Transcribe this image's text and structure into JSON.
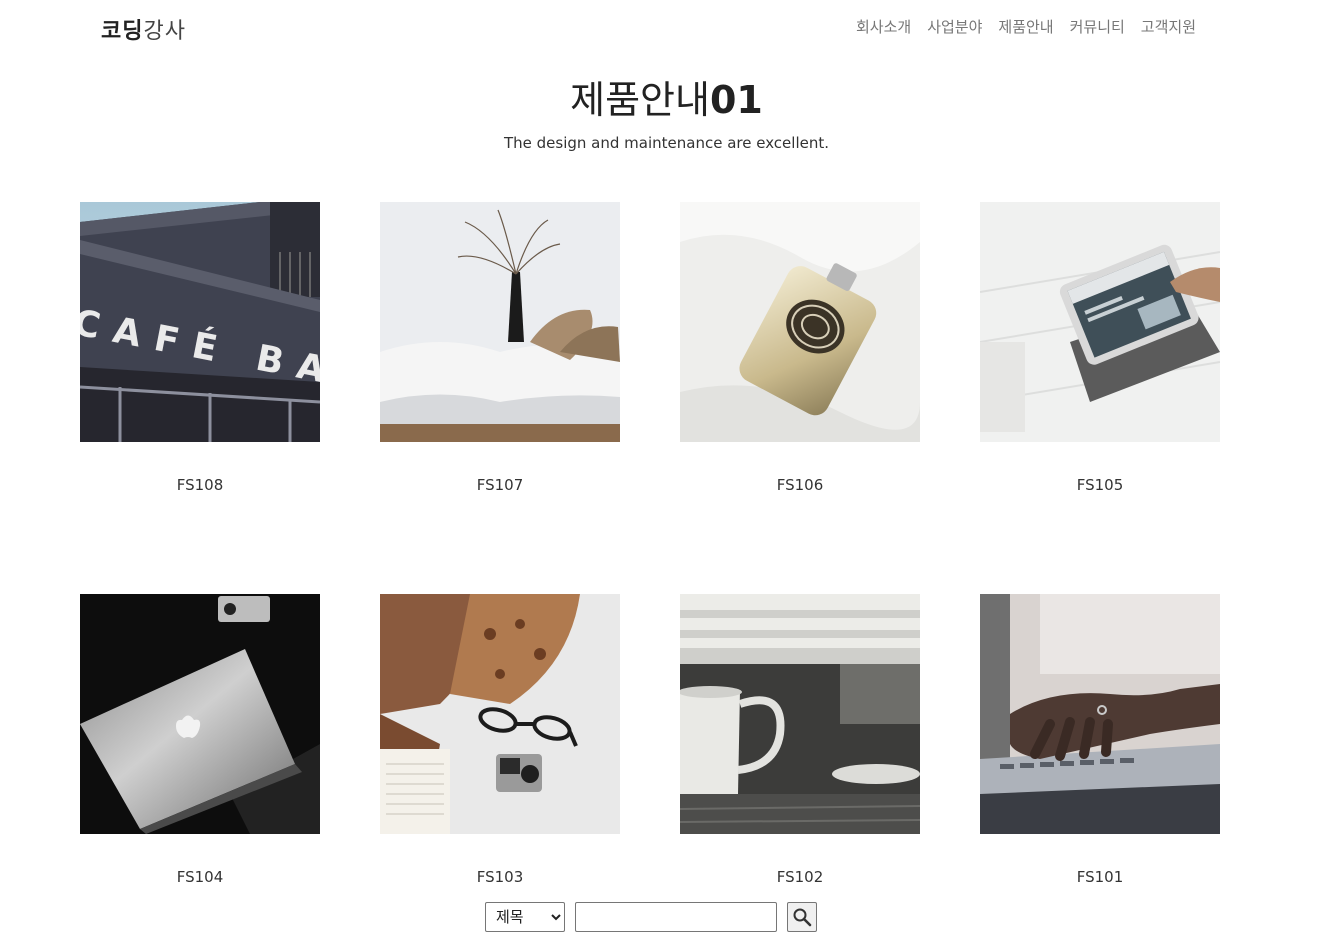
{
  "header": {
    "logo_main": "코딩",
    "logo_sub": "강사",
    "nav": [
      "회사소개",
      "사업분야",
      "제품안내",
      "커뮤니티",
      "고객지원"
    ]
  },
  "page": {
    "title_text": "제품안내",
    "title_num": "01",
    "description": "The design and maintenance are excellent."
  },
  "products": [
    {
      "code": "FS108",
      "image": "cafe-storefront-photo",
      "sign_text": "CAFÉ BA"
    },
    {
      "code": "FS107",
      "image": "white-sofa-photo"
    },
    {
      "code": "FS106",
      "image": "hip-flask-photo"
    },
    {
      "code": "FS105",
      "image": "tablet-photo"
    },
    {
      "code": "FS104",
      "image": "laptop-photo"
    },
    {
      "code": "FS103",
      "image": "desk-items-photo"
    },
    {
      "code": "FS102",
      "image": "coffee-cup-photo"
    },
    {
      "code": "FS101",
      "image": "typing-hands-photo"
    }
  ],
  "search": {
    "select_options": [
      "제목"
    ],
    "selected": "제목",
    "input_value": "",
    "button_icon": "search-icon"
  }
}
